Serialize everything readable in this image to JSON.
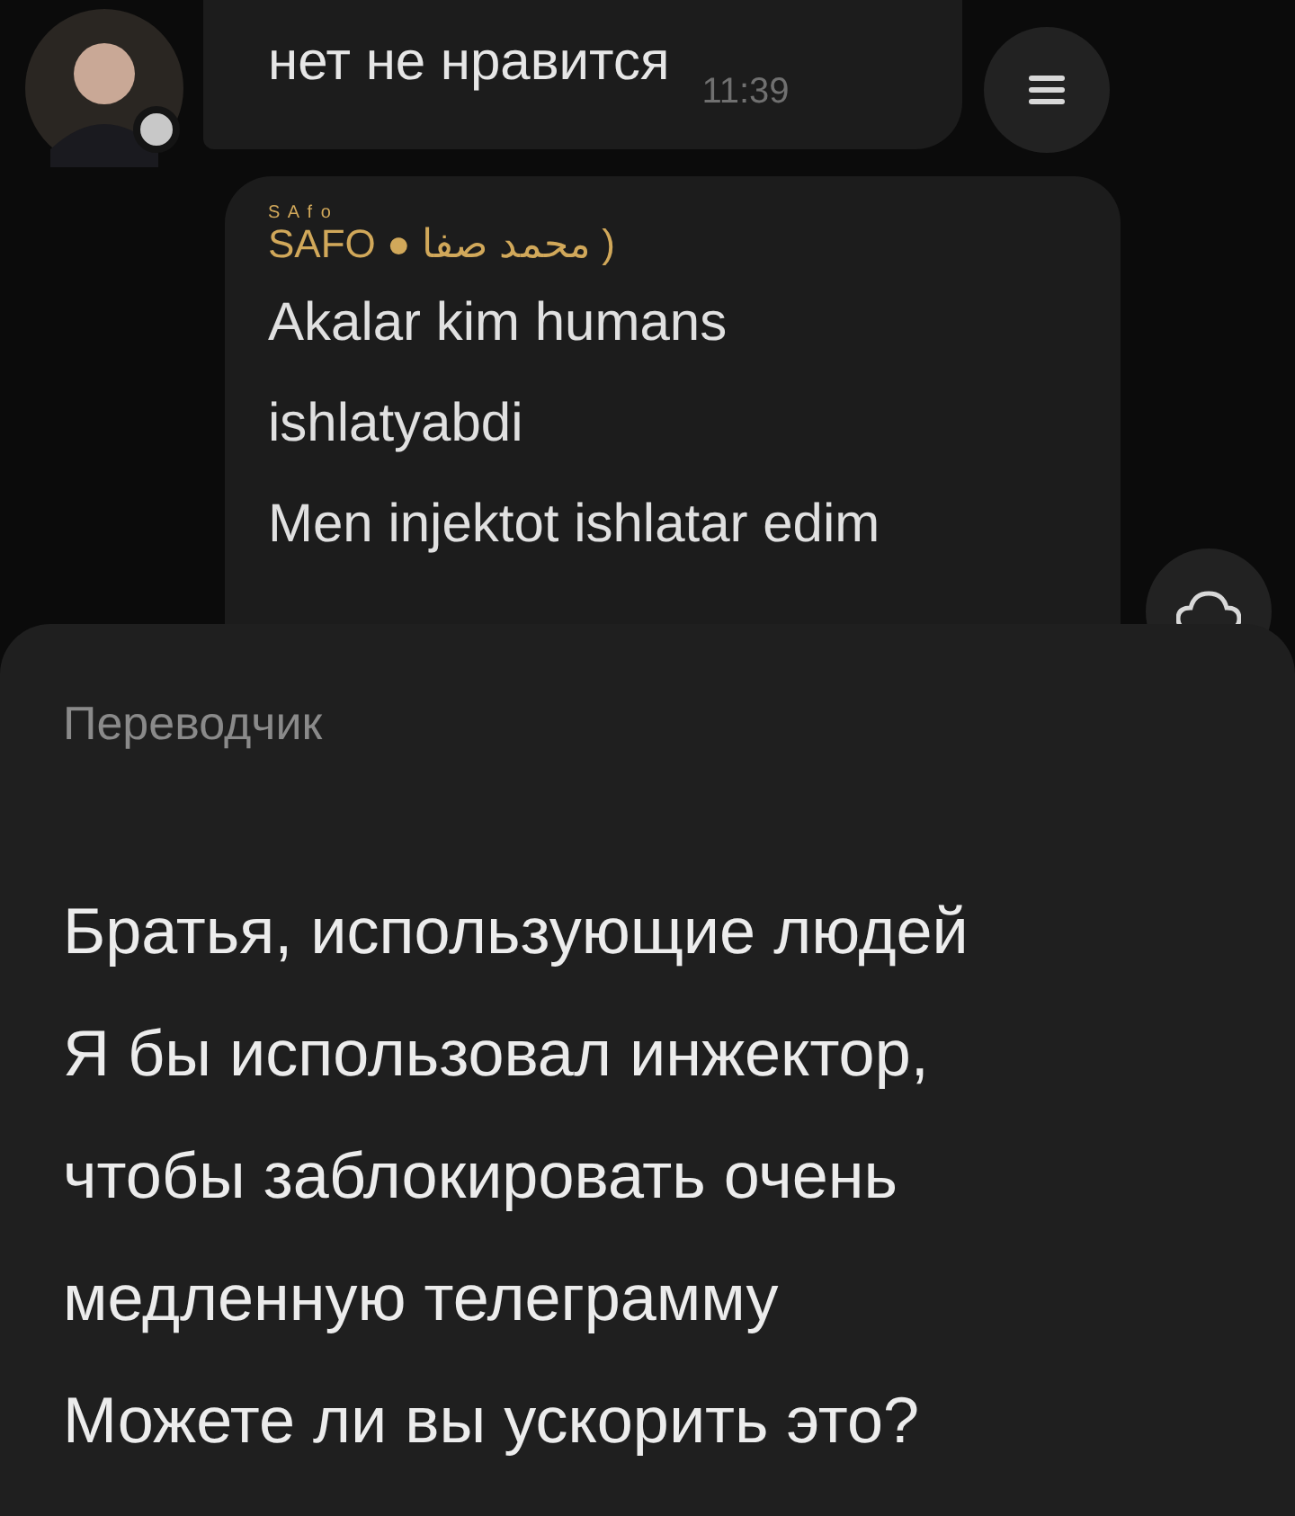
{
  "messages": [
    {
      "text": "нет не нравится",
      "time": "11:39"
    },
    {
      "sender_mark": "S A f o",
      "sender": "SAFO ● محمد صفا )",
      "lines": [
        "Akalar kim humans",
        "ishlatyabdi",
        "Men injektot ishlatar edim"
      ]
    }
  ],
  "translator": {
    "title": "Переводчик",
    "lines": [
      "Братья, использующие людей",
      "Я бы использовал инжектор,",
      "чтобы заблокировать очень",
      "медленную телеграмму",
      "Можете ли вы ускорить это?"
    ]
  }
}
